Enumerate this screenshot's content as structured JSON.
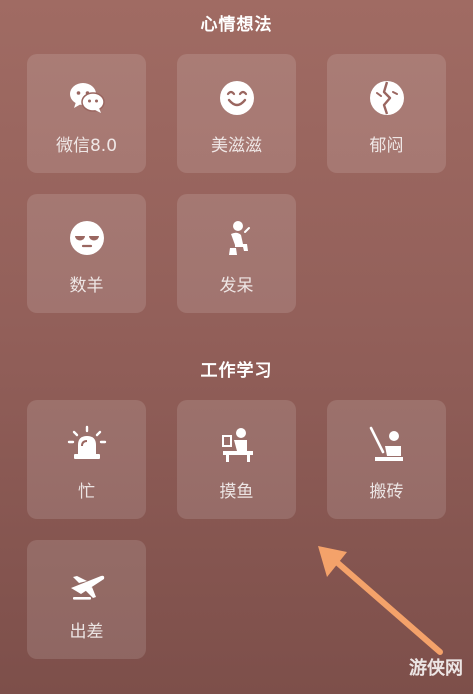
{
  "sections": [
    {
      "title": "心情想法",
      "items": [
        {
          "label": "微信8.0",
          "icon": "wechat-icon"
        },
        {
          "label": "美滋滋",
          "icon": "smile-face-icon"
        },
        {
          "label": "郁闷",
          "icon": "broken-heart-icon"
        },
        {
          "label": "数羊",
          "icon": "sleepy-face-icon"
        },
        {
          "label": "发呆",
          "icon": "sitting-person-icon"
        }
      ]
    },
    {
      "title": "工作学习",
      "items": [
        {
          "label": "忙",
          "icon": "alarm-light-icon"
        },
        {
          "label": "摸鱼",
          "icon": "person-at-desk-icon"
        },
        {
          "label": "搬砖",
          "icon": "brick-worker-icon"
        },
        {
          "label": "出差",
          "icon": "airplane-icon"
        }
      ]
    }
  ],
  "watermark": "游侠网",
  "colors": {
    "background_top": "#a06b63",
    "background_bottom": "#7d4f4a",
    "tile": "rgba(255,255,255,0.13)",
    "arrow": "#f4a26a"
  }
}
